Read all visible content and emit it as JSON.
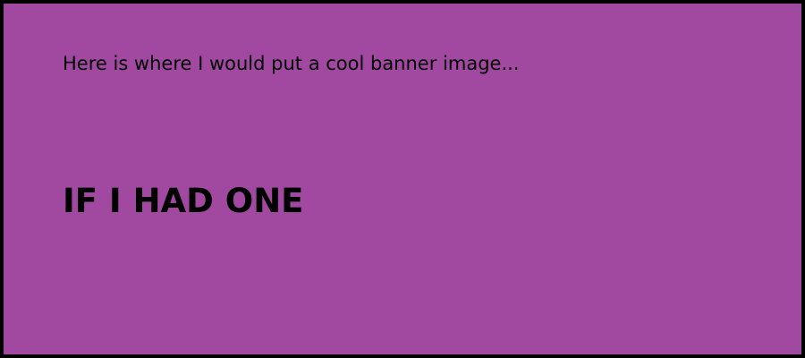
{
  "banner": {
    "background_color": "#a149a0",
    "border_color": "#000000",
    "text_color": "#000000",
    "line1": "Here is where I would put a cool banner image...",
    "line2": "IF I HAD ONE"
  }
}
